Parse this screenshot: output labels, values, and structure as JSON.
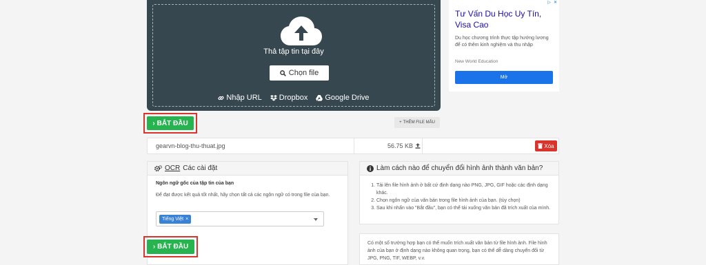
{
  "upload": {
    "drop_text": "Thả tập tin tại đây",
    "choose_file_label": "Chọn file",
    "sources": [
      {
        "label": "Nhập URL",
        "icon": "link-icon"
      },
      {
        "label": "Dropbox",
        "icon": "dropbox-icon"
      },
      {
        "label": "Google Drive",
        "icon": "google-drive-icon"
      }
    ]
  },
  "start_button_label": "BẮT ĐẦU",
  "add_sample_label": "THÊM FILE MẪU",
  "file": {
    "name": "gearvn-blog-thu-thuat.jpg",
    "size": "56.75 KB",
    "delete_label": "Xóa"
  },
  "settings": {
    "title_ocr": "OCR",
    "title_rest": "Các cài đặt",
    "language_title": "Ngôn ngữ gốc của tập tin của bạn",
    "language_help": "Để đạt được kết quả tốt nhất, hãy chọn tất cả các ngôn ngữ có trong file của bạn.",
    "selected_language": "Tiếng Việt"
  },
  "howto": {
    "title": "Làm cách nào để chuyển đổi hình ảnh thành văn bản?",
    "steps": [
      "Tải lên file hình ảnh ở bất cứ định dạng nào PNG, JPG, GIF hoặc các định dạng khác.",
      "Chọn ngôn ngữ của văn bản trong file hình ảnh của bạn. (tùy chọn)",
      "Sau khi nhấn vào \"Bắt đầu\", bạn có thể tải xuống văn bản đã trích xuất của mình."
    ],
    "info": "Có một số trường hợp bạn có thể muốn trích xuất văn bản từ file hình ảnh. File hình ảnh của bạn ở định dạng nào không quan trọng, bạn có thể dễ dàng chuyển đổi từ JPG, PNG, TIF, WEBP, v.v."
  },
  "ad": {
    "title": "Tư Vấn Du Học Uy Tín, Visa Cao",
    "description": "Du học chương trình thực tập hướng lương để có thêm kinh nghiệm và thu nhập",
    "source": "New World Education",
    "button_label": "Mở"
  },
  "colors": {
    "upload_bg": "#37474f",
    "start_green": "#27b350",
    "highlight_red": "#d9342b",
    "tag_blue": "#3a82d6",
    "ad_blue": "#1a73e8"
  }
}
